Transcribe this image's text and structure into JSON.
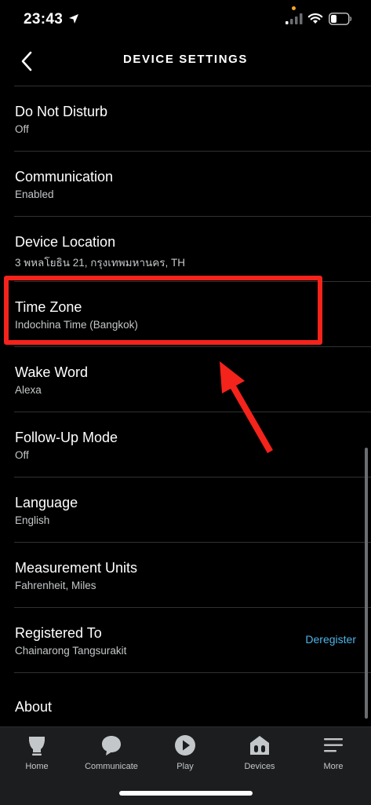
{
  "status_bar": {
    "time": "23:43"
  },
  "header": {
    "title": "DEVICE SETTINGS"
  },
  "settings": [
    {
      "title": "Do Not Disturb",
      "subtitle": "Off"
    },
    {
      "title": "Communication",
      "subtitle": "Enabled"
    },
    {
      "title": "Device Location",
      "subtitle": "3 พหลโยธิน 21, กรุงเทพมหานคร, TH"
    },
    {
      "title": "Time Zone",
      "subtitle": "Indochina Time (Bangkok)"
    },
    {
      "title": "Wake Word",
      "subtitle": "Alexa"
    },
    {
      "title": "Follow-Up Mode",
      "subtitle": "Off"
    },
    {
      "title": "Language",
      "subtitle": "English"
    },
    {
      "title": "Measurement Units",
      "subtitle": "Fahrenheit, Miles"
    },
    {
      "title": "Registered To",
      "subtitle": "Chainarong Tangsurakit",
      "action": "Deregister"
    },
    {
      "title": "About"
    }
  ],
  "tabs": [
    {
      "label": "Home",
      "icon": "home-icon"
    },
    {
      "label": "Communicate",
      "icon": "chat-bubble-icon"
    },
    {
      "label": "Play",
      "icon": "play-icon"
    },
    {
      "label": "Devices",
      "icon": "devices-icon"
    },
    {
      "label": "More",
      "icon": "menu-icon"
    }
  ],
  "colors": {
    "accent": "#4fb3e8",
    "highlight": "#f4231b",
    "background": "#000000",
    "tab_bar": "#1b1d1f"
  }
}
